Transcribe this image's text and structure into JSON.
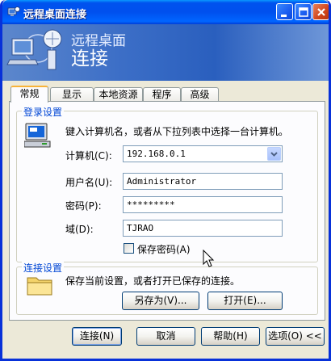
{
  "window": {
    "title": "远程桌面连接",
    "banner_line1": "远程桌面",
    "banner_line2": "连接",
    "colors": {
      "titlebar": "#0053ee",
      "banner": "#3d6fc7",
      "legend": "#0046d5",
      "face": "#ece9d8"
    }
  },
  "tabs": [
    {
      "label": "常规",
      "active": true
    },
    {
      "label": "显示"
    },
    {
      "label": "本地资源"
    },
    {
      "label": "程序"
    },
    {
      "label": "高级"
    }
  ],
  "login": {
    "legend": "登录设置",
    "hint": "键入计算机名，或者从下拉列表中选择一台计算机。",
    "computer_label": "计算机(C):",
    "computer_value": "192.168.0.1",
    "username_label": "用户名(U):",
    "username_value": "Administrator",
    "password_label": "密码(P):",
    "password_value": "*********",
    "domain_label": "域(D):",
    "domain_value": "TJRAO",
    "save_password_label": "保存密码(A)",
    "save_password_checked": false
  },
  "connection": {
    "legend": "连接设置",
    "hint": "保存当前设置，或者打开已保存的连接。",
    "save_as_label": "另存为(V)...",
    "open_label": "打开(E)..."
  },
  "footer": {
    "connect_label": "连接(N)",
    "cancel_label": "取消",
    "help_label": "帮助(H)",
    "options_label": "选项(O) <<"
  },
  "icons": [
    "app-icon",
    "minimize-icon",
    "maximize-icon",
    "close-icon",
    "computers-logo-icon",
    "computer-icon",
    "dropdown-arrow-icon",
    "folder-icon",
    "mouse-cursor-icon"
  ]
}
